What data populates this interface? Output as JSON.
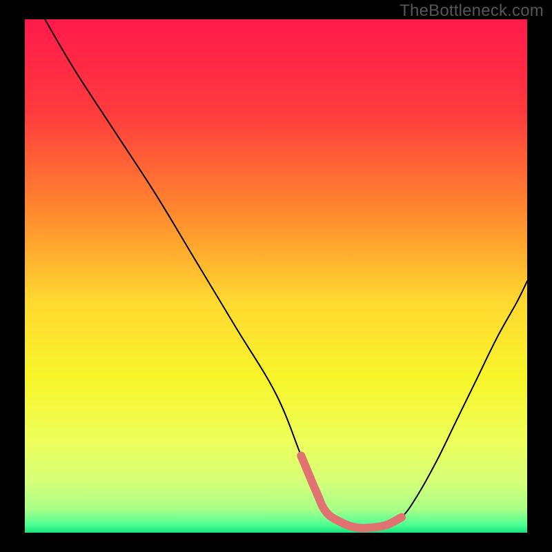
{
  "watermark": "TheBottleneck.com",
  "chart_data": {
    "type": "line",
    "title": "",
    "xlabel": "",
    "ylabel": "",
    "xlim": [
      0,
      100
    ],
    "ylim": [
      0,
      100
    ],
    "grid": false,
    "legend": false,
    "series": [
      {
        "name": "bottleneck-curve",
        "x": [
          4,
          10,
          18,
          26,
          34,
          42,
          50,
          55,
          58,
          60,
          63,
          66,
          69,
          72,
          75,
          78,
          82,
          86,
          90,
          94,
          98,
          100
        ],
        "values": [
          100,
          90,
          78,
          66,
          53,
          40,
          27,
          15,
          8,
          4,
          2,
          1,
          1,
          1.5,
          3,
          7,
          14,
          22,
          30,
          38,
          45,
          49
        ]
      },
      {
        "name": "highlight-segment",
        "x": [
          55,
          58,
          60,
          63,
          66,
          69,
          72,
          75
        ],
        "values": [
          15,
          8,
          4,
          2,
          1,
          1,
          1.5,
          3
        ]
      }
    ],
    "background_gradient": {
      "stops": [
        {
          "offset": 0.0,
          "color": "#ff1a4b"
        },
        {
          "offset": 0.18,
          "color": "#ff3a3e"
        },
        {
          "offset": 0.38,
          "color": "#ff8b2e"
        },
        {
          "offset": 0.55,
          "color": "#ffd930"
        },
        {
          "offset": 0.7,
          "color": "#f7f52a"
        },
        {
          "offset": 0.82,
          "color": "#eeff5a"
        },
        {
          "offset": 0.9,
          "color": "#d6ff79"
        },
        {
          "offset": 0.955,
          "color": "#a8ff88"
        },
        {
          "offset": 0.985,
          "color": "#4dff93"
        },
        {
          "offset": 1.0,
          "color": "#18e27e"
        }
      ]
    },
    "colors": {
      "curve": "#000000",
      "highlight": "#e17272"
    }
  }
}
